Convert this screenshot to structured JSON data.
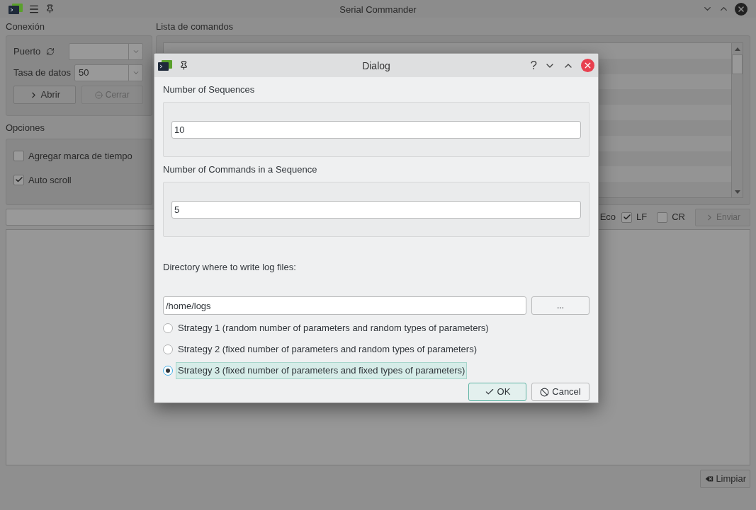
{
  "window": {
    "title": "Serial Commander"
  },
  "connection": {
    "heading": "Conexión",
    "port_label": "Puerto",
    "rate_label": "Tasa de datos",
    "rate_value": "50",
    "open_button": {
      "label": "Abrir",
      "disabled": false
    },
    "close_button": {
      "label": "Cerrar",
      "disabled": true
    }
  },
  "options": {
    "heading": "Opciones",
    "checkboxes": [
      {
        "label": "Agregar marca de tiempo",
        "checked": false
      },
      {
        "label": "Auto scroll",
        "checked": true
      }
    ]
  },
  "command_list": {
    "heading": "Lista de comandos"
  },
  "send_bar": {
    "partial_label": "Eco",
    "checkboxes": [
      {
        "label": "LF",
        "checked": true
      },
      {
        "label": "CR",
        "checked": false
      }
    ],
    "send_button": {
      "label": "Enviar",
      "disabled": true
    }
  },
  "clear_button": "Limpiar",
  "dialog": {
    "title": "Dialog",
    "help": "?",
    "sections": [
      {
        "label": "Number of Sequences",
        "value": "10"
      },
      {
        "label": "Number of Commands in a Sequence",
        "value": "5"
      }
    ],
    "directory_label": "Directory where to write log files:",
    "directory_value": "/home/logs",
    "browse_button": "...",
    "strategies": [
      {
        "label": "Strategy 1 (random number of parameters and random types of parameters)",
        "selected": false
      },
      {
        "label": "Strategy 2 (fixed number of parameters and random types of parameters)",
        "selected": false
      },
      {
        "label": "Strategy 3 (fixed number of parameters and fixed types of parameters)",
        "selected": true
      }
    ],
    "ok_button": "OK",
    "cancel_button": "Cancel"
  }
}
